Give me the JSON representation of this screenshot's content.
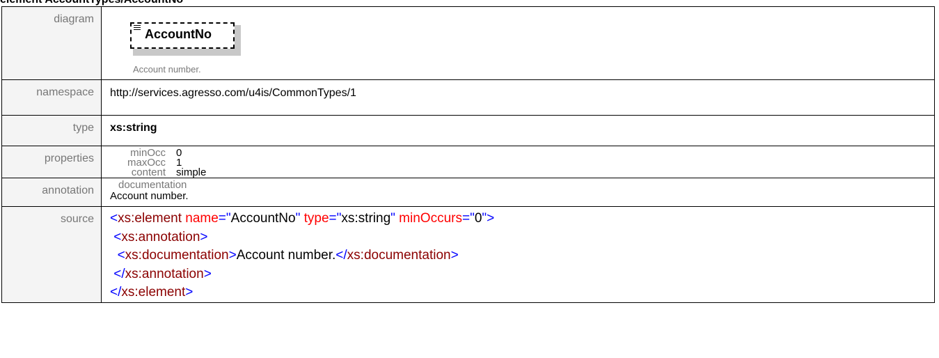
{
  "page": {
    "heading": "element AccountTypes/AccountNo"
  },
  "rows": {
    "diagram": {
      "label": "diagram",
      "element_name": "AccountNo",
      "element_doc": "Account number.",
      "icon": "sequence-lines-icon"
    },
    "namespace": {
      "label": "namespace",
      "value": "http://services.agresso.com/u4is/CommonTypes/1"
    },
    "type": {
      "label": "type",
      "value": "xs:string"
    },
    "properties": {
      "label": "properties",
      "items": [
        {
          "key": "minOcc",
          "value": "0"
        },
        {
          "key": "maxOcc",
          "value": "1"
        },
        {
          "key": "content",
          "value": "simple"
        }
      ]
    },
    "annotation": {
      "label": "annotation",
      "key": "documentation",
      "value": "Account number."
    },
    "source": {
      "label": "source",
      "line1": {
        "open": "<",
        "tag": "xs:element",
        "attr1": "name",
        "eq1": "=\"",
        "val1": "AccountNo",
        "q1": "\"",
        "attr2": "type",
        "eq2": "=\"",
        "val2": "xs:string",
        "q2": "\"",
        "attr3": "minOccurs",
        "eq3": "=\"",
        "val3": "0",
        "close": "\">"
      },
      "line2": {
        "open": "<",
        "tag": "xs:annotation",
        "close": ">"
      },
      "line3": {
        "open": "<",
        "tag": "xs:documentation",
        "gt": ">",
        "text": "Account number.",
        "lt2": "</",
        "tag2": "xs:documentation",
        "close": ">"
      },
      "line4": {
        "open": "</",
        "tag": "xs:annotation",
        "close": ">"
      },
      "line5": {
        "open": "</",
        "tag": "xs:element",
        "close": ">"
      }
    }
  },
  "colors": {
    "label_bg": "#f4f4f4",
    "label_text": "#777777",
    "xml_bracket": "#0000ff",
    "xml_name": "#8b0000",
    "xml_attr": "#ff0000"
  }
}
